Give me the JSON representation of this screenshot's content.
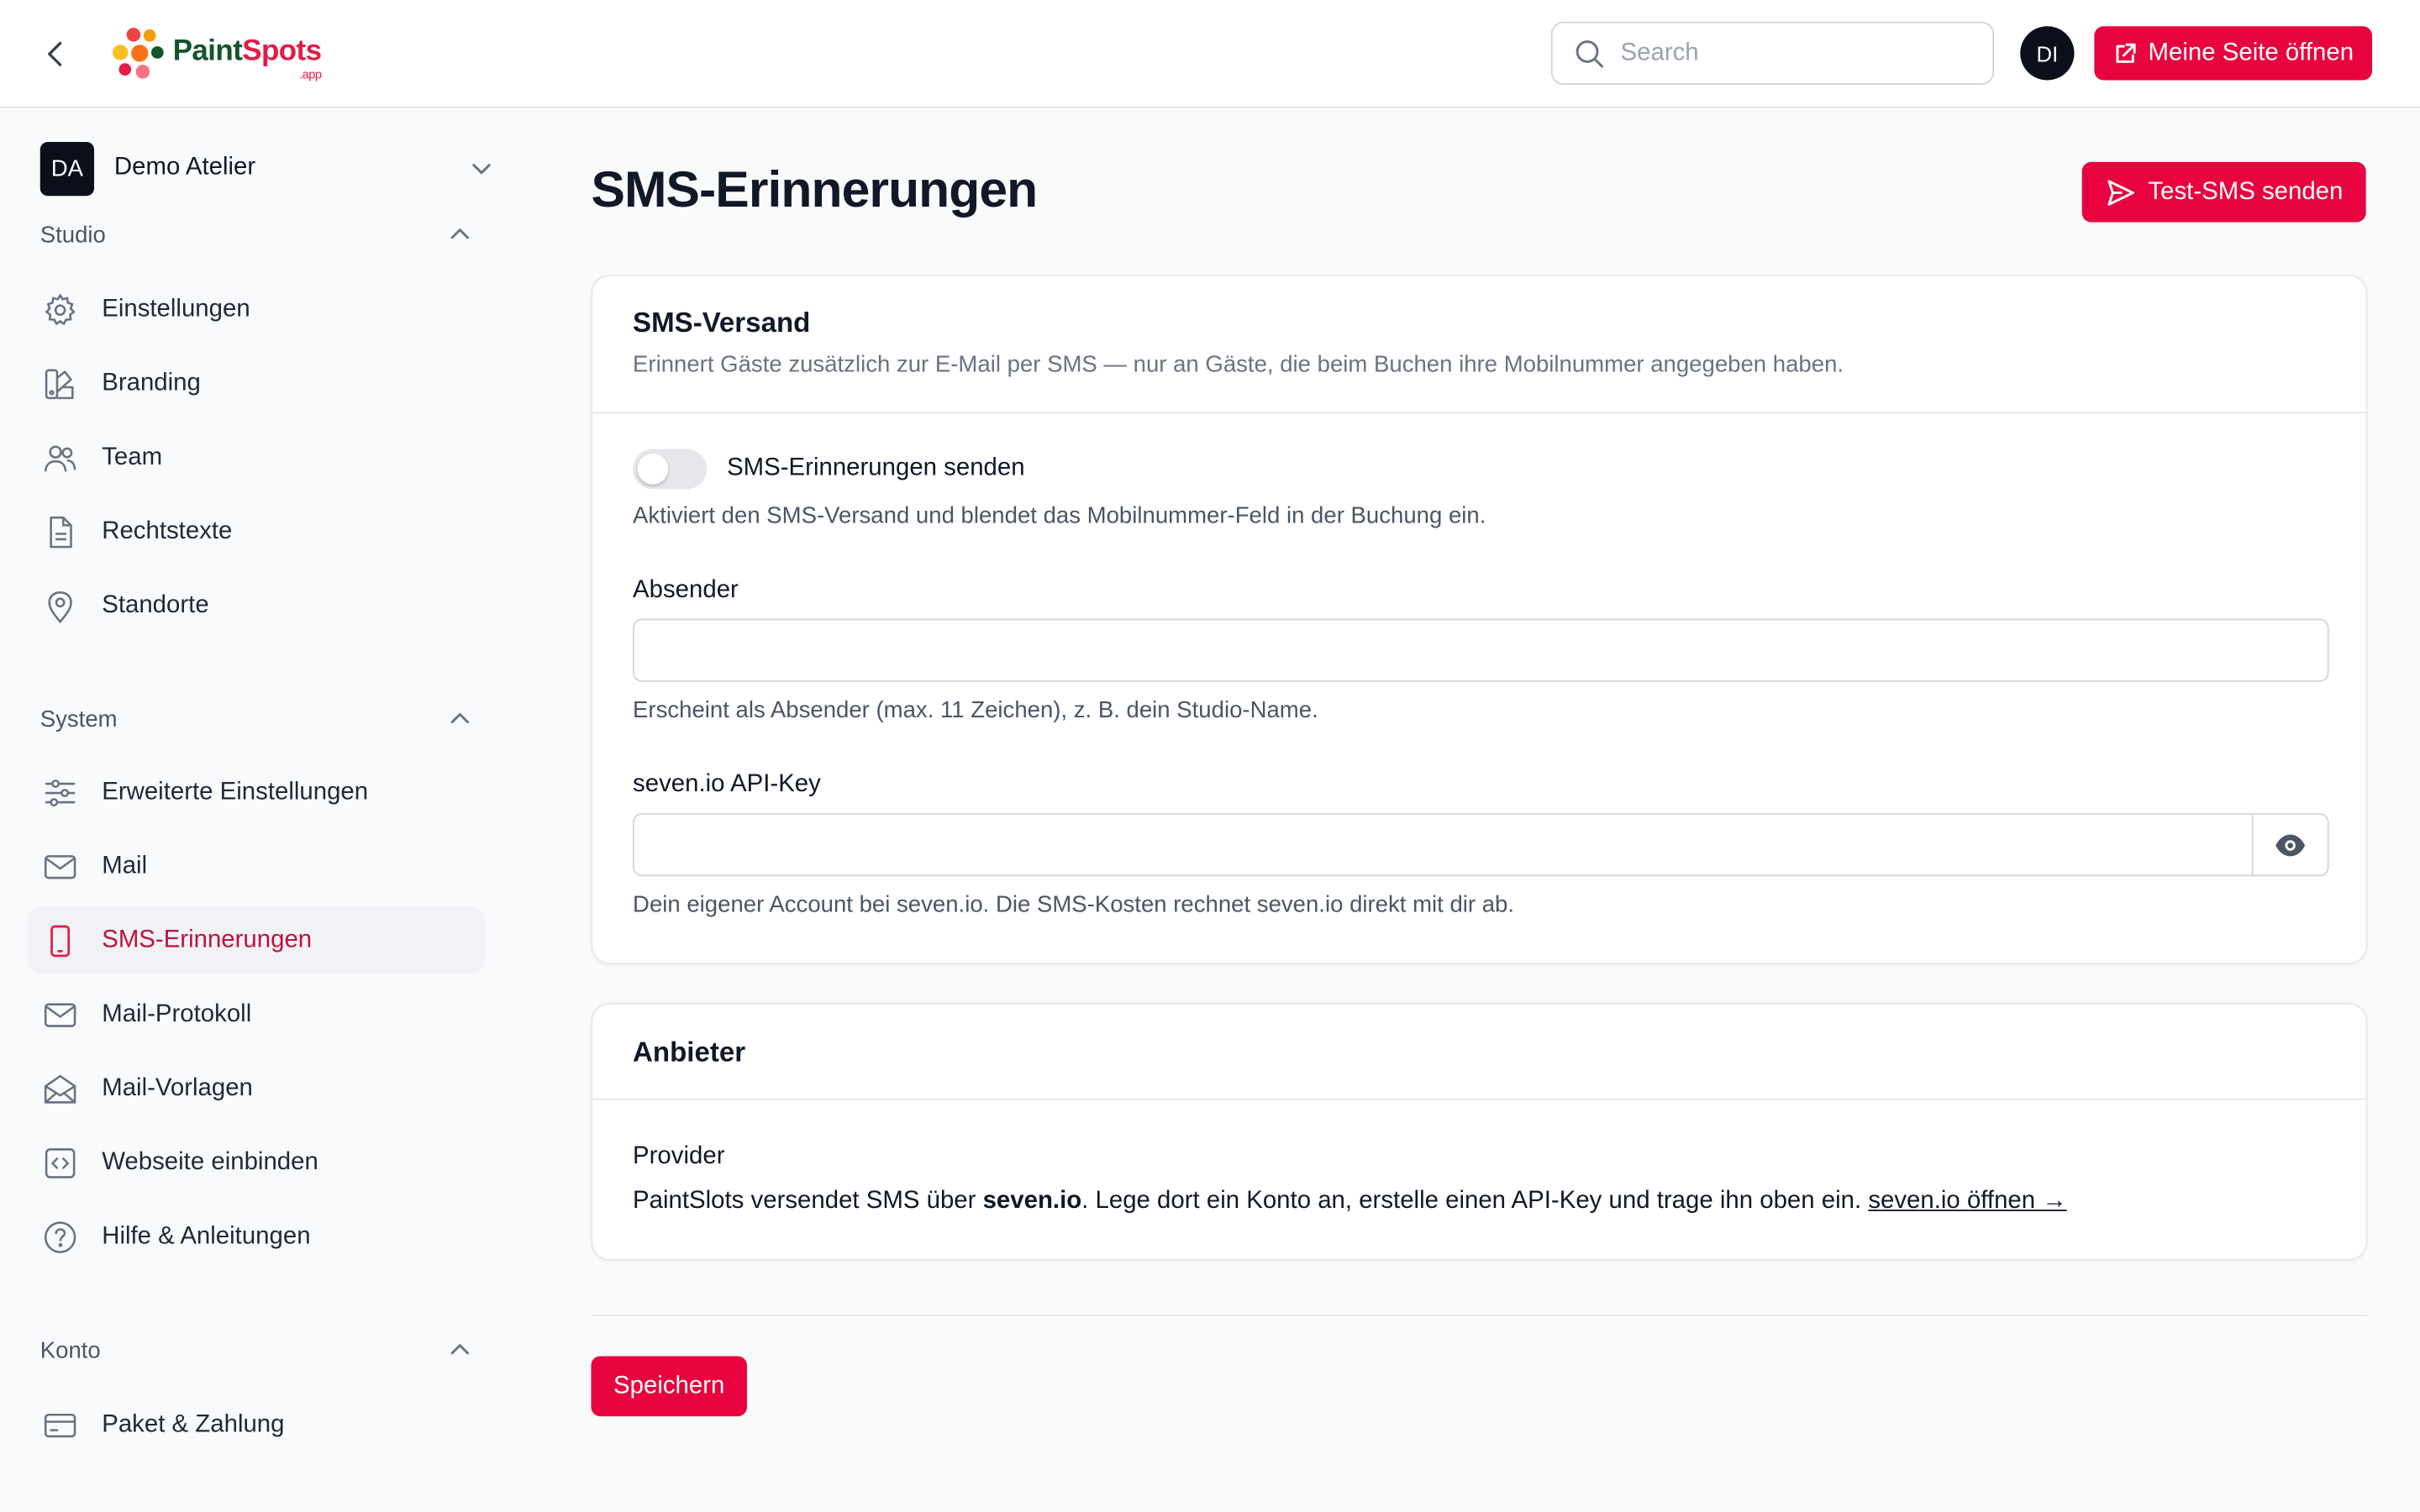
{
  "header": {
    "logo_text_a": "Paint",
    "logo_text_b": "Spots",
    "logo_suffix": ".app",
    "search_placeholder": "Search",
    "user_initials": "DI",
    "open_page_label": "Meine Seite öffnen"
  },
  "sidebar": {
    "studio_initials": "DA",
    "studio_name": "Demo Atelier",
    "sections": [
      {
        "label": "Studio",
        "items": [
          {
            "label": "Einstellungen",
            "icon": "gear-icon"
          },
          {
            "label": "Branding",
            "icon": "palette-icon"
          },
          {
            "label": "Team",
            "icon": "users-icon"
          },
          {
            "label": "Rechtstexte",
            "icon": "document-icon"
          },
          {
            "label": "Standorte",
            "icon": "map-pin-icon"
          }
        ]
      },
      {
        "label": "System",
        "items": [
          {
            "label": "Erweiterte Einstellungen",
            "icon": "sliders-icon"
          },
          {
            "label": "Mail",
            "icon": "envelope-icon"
          },
          {
            "label": "SMS-Erinnerungen",
            "icon": "phone-icon",
            "active": true
          },
          {
            "label": "Mail-Protokoll",
            "icon": "envelope-icon"
          },
          {
            "label": "Mail-Vorlagen",
            "icon": "envelope-open-icon"
          },
          {
            "label": "Webseite einbinden",
            "icon": "code-icon"
          },
          {
            "label": "Hilfe & Anleitungen",
            "icon": "question-circle-icon"
          }
        ]
      },
      {
        "label": "Konto",
        "items": [
          {
            "label": "Paket & Zahlung",
            "icon": "credit-card-icon"
          }
        ]
      }
    ]
  },
  "main": {
    "title": "SMS-Erinnerungen",
    "test_sms_label": "Test-SMS senden",
    "sms_card": {
      "title": "SMS-Versand",
      "description": "Erinnert Gäste zusätzlich zur E-Mail per SMS — nur an Gäste, die beim Buchen ihre Mobilnummer angegeben haben.",
      "toggle_label": "SMS-Erinnerungen senden",
      "toggle_on": false,
      "toggle_help": "Aktiviert den SMS-Versand und blendet das Mobilnummer-Feld in der Buchung ein.",
      "sender_label": "Absender",
      "sender_value": "",
      "sender_help": "Erscheint als Absender (max. 11 Zeichen), z. B. dein Studio-Name.",
      "apikey_label": "seven.io API-Key",
      "apikey_value": "",
      "apikey_help": "Dein eigener Account bei seven.io. Die SMS-Kosten rechnet seven.io direkt mit dir ab."
    },
    "provider_card": {
      "title": "Anbieter",
      "provider_label": "Provider",
      "text_before": "PaintSlots versendet SMS über ",
      "text_bold": "seven.io",
      "text_after": ". Lege dort ein Konto an, erstelle einen API-Key und trage ihn oben ein. ",
      "link_label": "seven.io öffnen →"
    },
    "save_label": "Speichern"
  },
  "colors": {
    "accent": "#e8033e",
    "active_text": "#be123c"
  }
}
